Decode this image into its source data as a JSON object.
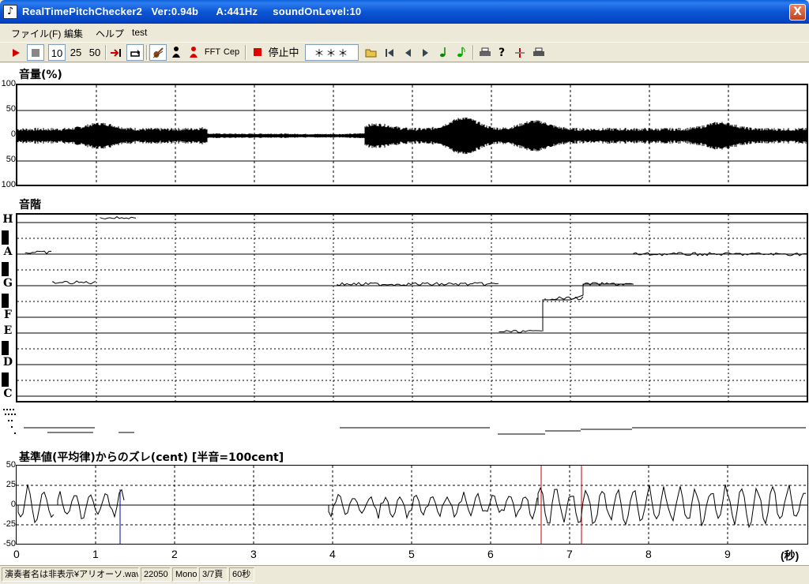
{
  "window": {
    "title": "RealTimePitchChecker2   Ver:0.94b      A:441Hz     soundOnLevel:10",
    "icon": "violin-note-icon",
    "close_label": "X"
  },
  "menu": [
    {
      "label": "ファイル(F)"
    },
    {
      "label": "編集"
    },
    {
      "label": "ヘルプ"
    },
    {
      "label": "test"
    }
  ],
  "toolbar": {
    "play_icon": "play-icon",
    "stop_icon": "stop-icon",
    "zoom_10": "10",
    "zoom_25": "25",
    "zoom_50": "50",
    "jump_end_icon": "jump-end-icon",
    "loop_icon": "loop-icon",
    "violin_icon": "violin-icon",
    "person_icon": "person-icon",
    "person_red_icon": "person-red-icon",
    "fft_label": "FFT",
    "cep_label": "Cep",
    "record_icon": "record-icon",
    "status_label": "停止中",
    "stars_label": "＊＊＊",
    "open_icon": "folder-open-icon",
    "first_icon": "skip-first-icon",
    "prev_icon": "prev-icon",
    "next_icon": "next-icon",
    "note_green_icon": "note-icon",
    "note_green2_icon": "note-icon",
    "printer_icon": "printer-icon",
    "help_icon": "help-icon",
    "split_icon": "split-icon",
    "print2_icon": "printer-icon"
  },
  "volume_panel": {
    "title": "音量(%)",
    "y_labels": [
      "100",
      "50",
      "0",
      "50",
      "100"
    ]
  },
  "scale_panel": {
    "title": "音階",
    "notes": [
      "H",
      "A",
      "G",
      "F",
      "E",
      "D",
      "C"
    ]
  },
  "deviation_panel": {
    "title": "基準値(平均律)からのズレ(cent) [半音=100cent]",
    "y_labels": [
      "50",
      "25",
      "0",
      "-25",
      "-50"
    ]
  },
  "x_axis": {
    "labels": [
      "0",
      "1",
      "2",
      "3",
      "4",
      "5",
      "6",
      "7",
      "8",
      "9"
    ],
    "unit": "(秒)"
  },
  "statusbar": {
    "file": "演奏者名は非表示¥アリオーソ.wav",
    "rate": "22050",
    "channels": "Mono",
    "page": "3/7頁",
    "duration": "60秒"
  },
  "colors": {
    "titlebar": "#0b56d4",
    "marker_red": "#cc0000",
    "marker_blue": "#0000aa"
  }
}
